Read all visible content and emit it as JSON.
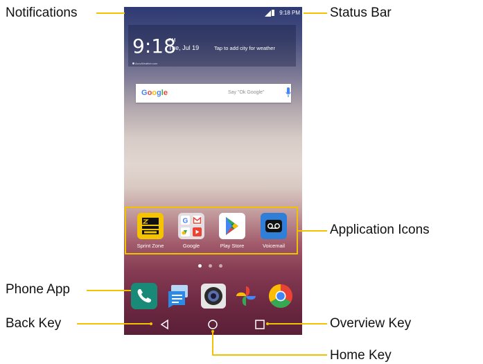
{
  "callouts": {
    "notifications": "Notifications",
    "status_bar": "Status Bar",
    "application_icons": "Application Icons",
    "phone_app": "Phone App",
    "back_key": "Back Key",
    "overview_key": "Overview Key",
    "home_key": "Home Key"
  },
  "colors": {
    "callout_line": "#f2c200"
  },
  "status_bar": {
    "time": "9:18 PM",
    "icons": [
      "signal-icon",
      "battery-icon"
    ]
  },
  "clock_widget": {
    "time": "9:18",
    "ampm": "PM",
    "date": "Tue, Jul 19",
    "weather_prompt": "Tap to add city for weather",
    "source": "AccuWeather.com"
  },
  "search": {
    "logo": "Google",
    "hint": "Say \"Ok Google\""
  },
  "apps": [
    {
      "label": "Sprint Zone",
      "icon": "sprint-zone-icon"
    },
    {
      "label": "Google",
      "icon": "google-folder-icon"
    },
    {
      "label": "Play Store",
      "icon": "play-store-icon"
    },
    {
      "label": "Voicemail",
      "icon": "voicemail-icon"
    }
  ],
  "dock": [
    "phone-icon",
    "messaging-icon",
    "camera-icon",
    "photos-icon",
    "chrome-icon"
  ],
  "nav": {
    "back": "back-key-icon",
    "home": "home-key-icon",
    "overview": "overview-key-icon"
  },
  "pager": {
    "pages": 3,
    "active": 1
  }
}
